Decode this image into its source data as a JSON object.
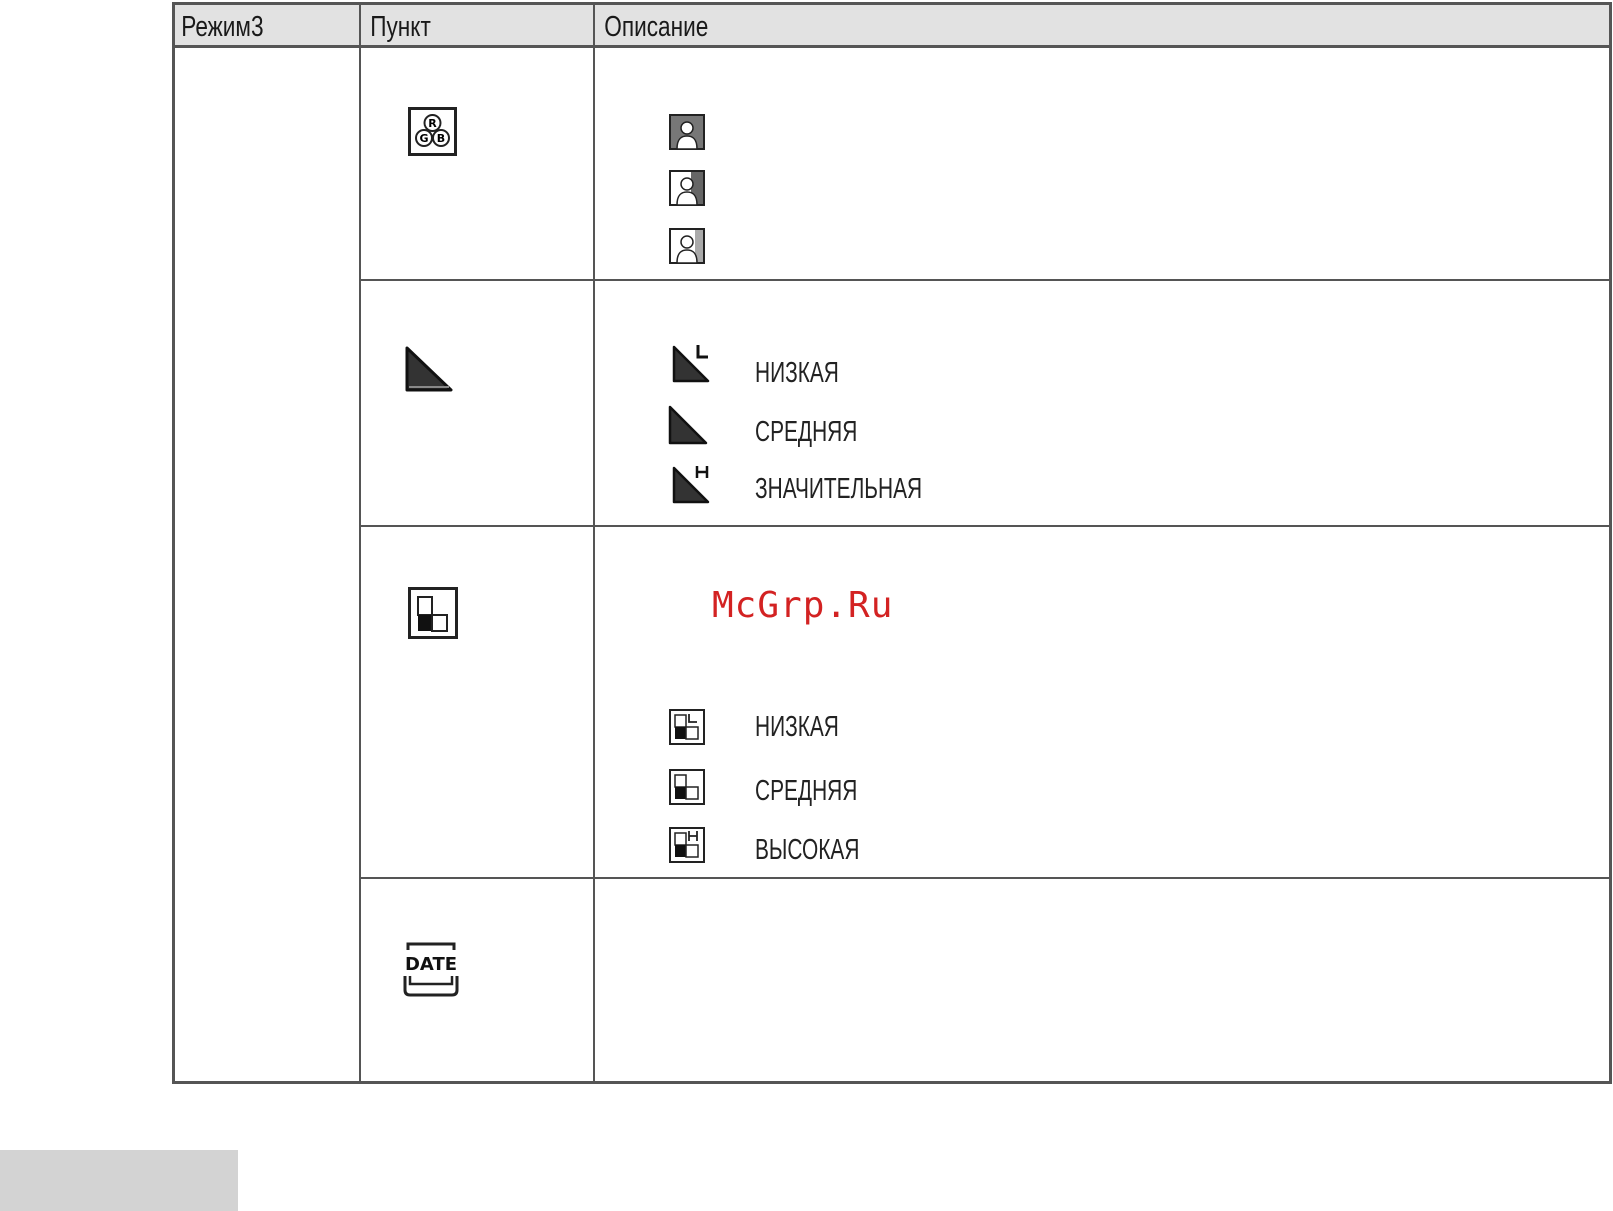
{
  "header": {
    "col_mode": "Режим3",
    "col_item": "Пункт",
    "col_desc": "Описание"
  },
  "rows": {
    "color": {
      "icon": "rgb-icon",
      "options": [
        "portrait-dark-icon",
        "portrait-mid-icon",
        "portrait-light-icon"
      ]
    },
    "sharpness": {
      "icon": "sharpness-icon",
      "options": [
        {
          "icon": "sharpness-low-icon",
          "label": "НИЗКАЯ"
        },
        {
          "icon": "sharpness-mid-icon",
          "label": "СРЕДНЯЯ"
        },
        {
          "icon": "sharpness-high-icon",
          "label": "ЗНАЧИТЕЛЬНАЯ"
        }
      ]
    },
    "contrast": {
      "icon": "contrast-icon",
      "options": [
        {
          "icon": "contrast-low-icon",
          "label": "НИЗКАЯ"
        },
        {
          "icon": "contrast-mid-icon",
          "label": "СРЕДНЯЯ"
        },
        {
          "icon": "contrast-high-icon",
          "label": "ВЫСОКАЯ"
        }
      ]
    },
    "date": {
      "icon": "date-icon",
      "icon_text": "DATE"
    }
  },
  "watermark": "McGrp.Ru"
}
